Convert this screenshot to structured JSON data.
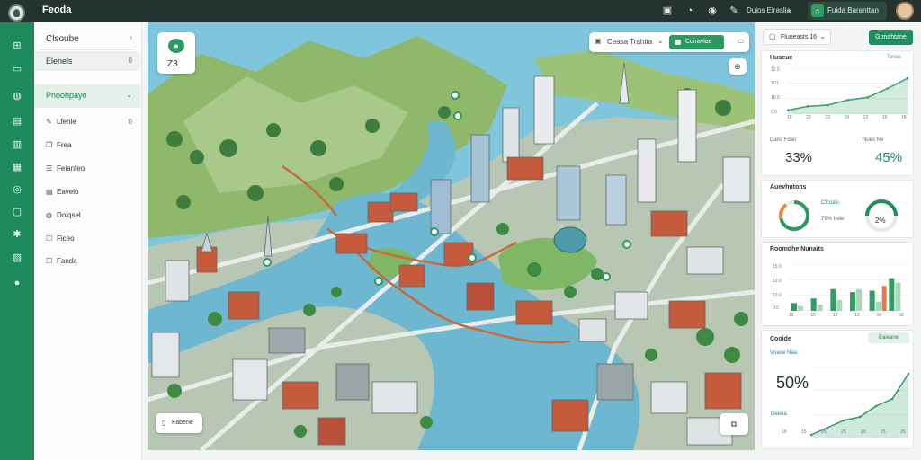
{
  "topbar": {
    "brand": "Feoda",
    "user_label": "Dulos Elraslia",
    "account_label": "Fuida Baranttan",
    "icons": [
      "cart-icon",
      "bell-icon",
      "help-icon",
      "edit-icon"
    ]
  },
  "rail": {
    "icons": [
      "grid-icon",
      "map-icon",
      "globe-icon",
      "chart-icon",
      "book-icon",
      "image-icon",
      "location-icon",
      "monitor-icon",
      "compass-icon",
      "report-icon",
      "chat-icon"
    ]
  },
  "sidebar": {
    "header": "Clsoube",
    "header_trail": "‹",
    "gray_item": "Elenels",
    "gray_trail": "0",
    "green_item": "Pnoohpayo",
    "green_trail": "⌄",
    "items": [
      {
        "label": "Lfenle",
        "trail": "0",
        "icon": "edit-icon"
      },
      {
        "label": "Frea",
        "icon": "copy-icon"
      },
      {
        "label": "Feianfeo",
        "icon": "list-icon"
      },
      {
        "label": "Eavelo",
        "icon": "list-icon"
      },
      {
        "label": "Doiqsel",
        "icon": "globe-icon"
      },
      {
        "label": "Ficeo",
        "icon": "square-icon"
      },
      {
        "label": "Fanda",
        "icon": "square-icon"
      }
    ]
  },
  "map": {
    "zoom_value": "Z3",
    "search_label": "Ceasa Trahtta",
    "search_button": "Coiraviae",
    "legend_label": "Fabene",
    "accent": "#2a9a62"
  },
  "right": {
    "date_label": "Fluneasts 16",
    "export_label": "Gtmahtane",
    "panel1": {
      "title": "Huseue",
      "meta": "Tonas",
      "y_ticks": [
        "12.0",
        "110",
        "10.0",
        "0.0"
      ],
      "x_ticks": [
        "19",
        "23",
        "23",
        "19",
        "13",
        "15",
        "18"
      ],
      "stat_label_left": "Dans Fdan",
      "stat_meta": "Nues Ne",
      "stat_left": "33%",
      "stat_right": "45%"
    },
    "panel2": {
      "title": "Auevhntons",
      "gauge1_label": "Cfcoals",
      "gauge1_sub": "75% Inde",
      "gauge2_value": "2%"
    },
    "panel3": {
      "title": "Roomdhe Nunaits",
      "y_ticks": [
        "15.0",
        "10.0",
        "10.0",
        "0.0"
      ],
      "x_ticks": [
        "15",
        "15",
        "18",
        "19",
        "10",
        "50"
      ]
    },
    "panel4": {
      "title": "Cooide",
      "badge": "Eaieane",
      "sub": "Vnaoe Naa",
      "big": "50%",
      "sub2": "Deeoa",
      "x_ticks": [
        "10",
        "15",
        "25",
        "25",
        "20",
        "25",
        "25"
      ]
    }
  },
  "chart_data": [
    {
      "type": "area",
      "x": [
        "19",
        "23",
        "23",
        "19",
        "13",
        "15",
        "18"
      ],
      "values": [
        1.0,
        2.0,
        2.3,
        3.6,
        4.3,
        6.6,
        9.2
      ],
      "ylim": [
        0,
        12
      ],
      "color": "#34a36b"
    },
    {
      "type": "bar",
      "categories": [
        "15",
        "15",
        "18",
        "19",
        "10",
        "50"
      ],
      "series": [
        {
          "values": [
            2.5,
            4.0,
            7.0,
            6.0,
            6.5,
            10.5
          ],
          "color": "#2f9e64"
        },
        {
          "values": [
            1.5,
            2.0,
            3.5,
            7.0,
            3.0,
            9.0
          ],
          "color": "#a7d8b9"
        }
      ],
      "highlight": {
        "index": 4,
        "value": 8.0,
        "color": "#e5774a"
      },
      "ylim": [
        0,
        15
      ]
    },
    {
      "type": "area",
      "x": [
        "10",
        "15",
        "25",
        "25",
        "20",
        "25",
        "25"
      ],
      "values": [
        0.5,
        1.5,
        2.5,
        3.0,
        4.5,
        5.5,
        9.0
      ],
      "ylim": [
        0,
        10
      ],
      "color": "#2a9a62"
    }
  ]
}
